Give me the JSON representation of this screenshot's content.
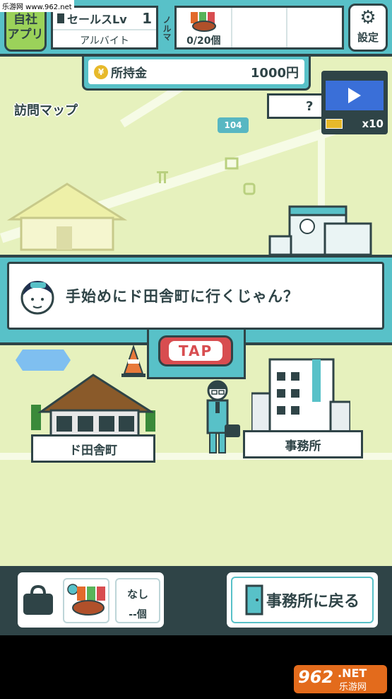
{
  "watermark_top": "乐游网 www.962.net",
  "hud": {
    "app_button": "自社\nアプリ",
    "sales_lv_label": "セールスLv",
    "sales_lv_value": "1",
    "job_title": "アルバイト",
    "quota_label": "ノルマ",
    "quota_value": "0/20個",
    "settings_label": "設定"
  },
  "money": {
    "label": "所持金",
    "value": "1000円"
  },
  "map": {
    "title": "訪問マップ",
    "unknown_place": "?",
    "route_number": "104",
    "video_tickets": "x10"
  },
  "dialog": {
    "text": "手始めにド田舎町に行くじゃん？"
  },
  "tap_button": "TAP",
  "places": [
    {
      "label": "ド田舎町"
    },
    {
      "label": "事務所"
    }
  ],
  "bottom": {
    "item_name": "なし",
    "item_count": "--個",
    "return_label": "事務所に戻る"
  },
  "watermark_bottom": {
    "number": "962",
    "suffix": ".NET",
    "site": "乐游网"
  },
  "colors": {
    "map_bg": "#e6f1bd",
    "hud_teal": "#58c1c8",
    "outline": "#2f4447",
    "tap_red": "#d84d50"
  }
}
